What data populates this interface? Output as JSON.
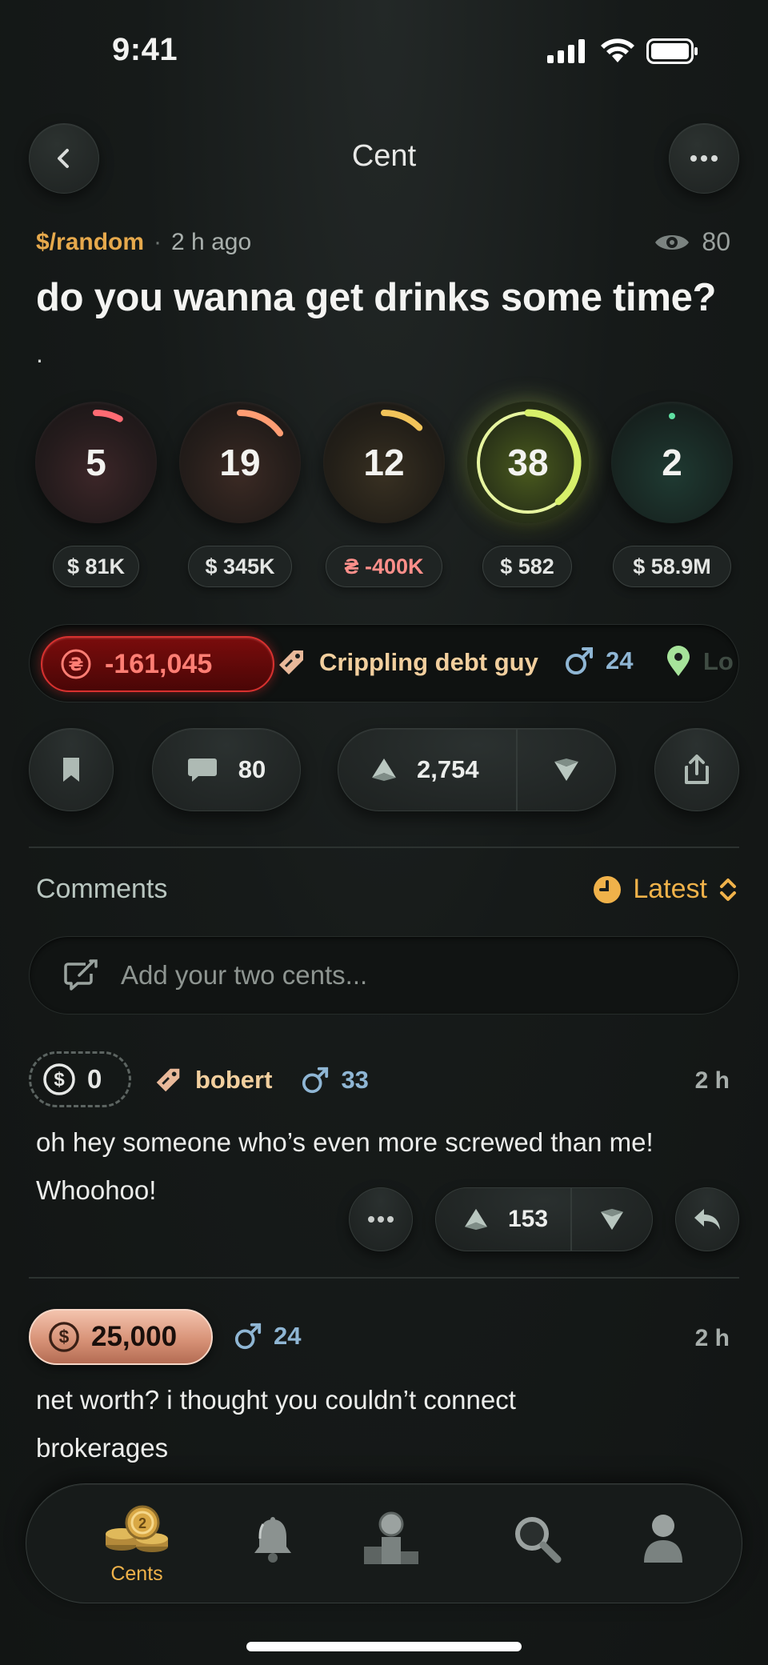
{
  "status_bar": {
    "time": "9:41"
  },
  "header": {
    "title": "Cent"
  },
  "post": {
    "community": "$/random",
    "separator": "·",
    "time_ago": "2 h ago",
    "views": "80",
    "title": "do you wanna get drinks some time?",
    "body": "."
  },
  "stats": [
    {
      "value": "5",
      "money": "$ 81K",
      "ring_color": "#ff6b73",
      "progress": 0.08
    },
    {
      "value": "19",
      "money": "$ 345K",
      "ring_color": "#ff9d73",
      "progress": 0.19
    },
    {
      "value": "12",
      "money": "₴ -400K",
      "ring_color": "#f2c45a",
      "progress": 0.14
    },
    {
      "value": "38",
      "money": "$ 582",
      "ring_color": "#d7f06a",
      "progress": 0.38
    },
    {
      "value": "2",
      "money": "$ 58.9M",
      "ring_color": "#5fe0a2",
      "progress": 0.02
    }
  ],
  "tags": {
    "net_worth": "-161,045",
    "title_tag": "Crippling debt guy",
    "age": "24",
    "location_partial": "Lo"
  },
  "actions": {
    "comments_count": "80",
    "vote_score": "2,754"
  },
  "comments_section": {
    "label": "Comments",
    "sort_label": "Latest",
    "compose_placeholder": "Add your two cents..."
  },
  "comments": [
    {
      "net_worth": "0",
      "username": "bobert",
      "age": "33",
      "time": "2 h",
      "text_line1": "oh hey someone who’s even more screwed than me!",
      "text_line2": "Whoohoo!",
      "score": "153"
    },
    {
      "net_worth": "25,000",
      "age": "24",
      "time": "2 h",
      "text_line1": "net worth? i thought you couldn’t connect",
      "text_line2": "brokerages"
    }
  ],
  "tabbar": {
    "active_label": "Cents"
  }
}
